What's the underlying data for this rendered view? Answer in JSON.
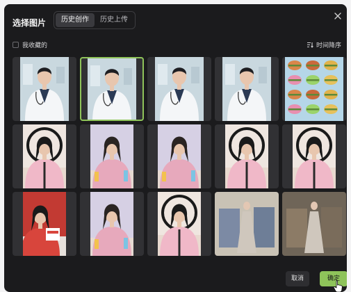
{
  "dialog": {
    "title": "选择图片",
    "tabs": [
      {
        "label": "历史创作",
        "active": true
      },
      {
        "label": "历史上传",
        "active": false
      }
    ],
    "favorites_label": "我收藏的",
    "sort_label": "时间降序",
    "cancel_label": "取消",
    "confirm_label": "确定"
  },
  "colors": {
    "accent": "#8fc45a",
    "background": "#1b1b1d",
    "tile": "#313134"
  },
  "grid": [
    {
      "type": "doctor",
      "selected": false
    },
    {
      "type": "doctor",
      "selected": true
    },
    {
      "type": "doctor",
      "selected": false
    },
    {
      "type": "doctor",
      "selected": false
    },
    {
      "type": "food-stickers",
      "selected": false
    },
    {
      "type": "ring-light-host",
      "selected": false
    },
    {
      "type": "presenter",
      "selected": false
    },
    {
      "type": "presenter",
      "selected": false
    },
    {
      "type": "ring-light-host",
      "selected": false
    },
    {
      "type": "ring-light-host",
      "selected": false
    },
    {
      "type": "red-booth-host",
      "selected": false
    },
    {
      "type": "presenter",
      "selected": false
    },
    {
      "type": "ring-light-host",
      "selected": false
    },
    {
      "type": "gown-model",
      "selected": false
    },
    {
      "type": "gown-model",
      "selected": false
    }
  ]
}
